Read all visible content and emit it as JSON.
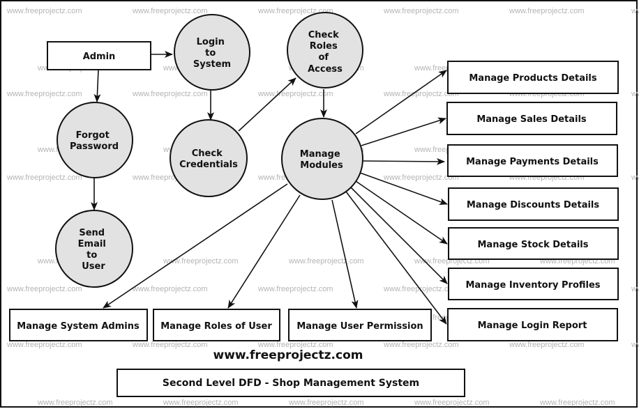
{
  "diagram": {
    "type": "Data Flow Diagram - Level 2",
    "title": "Second Level DFD - Shop Management System",
    "website": "www.freeprojectz.com",
    "watermark": "www.freeprojectz.com",
    "colors": {
      "process_fill": "#e2e2e2",
      "stroke": "#111111",
      "watermark": "#b4b4b4"
    },
    "entities": {
      "admin": "Admin",
      "products": "Manage Products Details",
      "sales": "Manage Sales Details",
      "payments": "Manage Payments Details",
      "discounts": "Manage Discounts Details",
      "stock": "Manage Stock Details",
      "inventory": "Manage Inventory Profiles",
      "login_report": "Manage Login Report",
      "system_admins": "Manage System Admins",
      "roles_of_user": "Manage Roles of User",
      "user_permission": "Manage User Permission"
    },
    "processes": {
      "login": [
        "Login",
        "to",
        "System"
      ],
      "check_roles": [
        "Check",
        "Roles",
        "of",
        "Access"
      ],
      "forgot": [
        "Forgot",
        "Password"
      ],
      "check_credentials": [
        "Check",
        "Credentials"
      ],
      "manage_modules": [
        "Manage",
        "Modules"
      ],
      "send_email": [
        "Send",
        "Email",
        "to",
        "User"
      ]
    },
    "flows": [
      [
        "Admin",
        "Login to System"
      ],
      [
        "Admin",
        "Forgot Password"
      ],
      [
        "Forgot Password",
        "Send Email to User"
      ],
      [
        "Login to System",
        "Check Credentials"
      ],
      [
        "Check Credentials",
        "Check Roles of Access"
      ],
      [
        "Check Roles of Access",
        "Manage Modules"
      ],
      [
        "Manage Modules",
        "Manage Products Details"
      ],
      [
        "Manage Modules",
        "Manage Sales Details"
      ],
      [
        "Manage Modules",
        "Manage Payments Details"
      ],
      [
        "Manage Modules",
        "Manage Discounts Details"
      ],
      [
        "Manage Modules",
        "Manage Stock Details"
      ],
      [
        "Manage Modules",
        "Manage Inventory Profiles"
      ],
      [
        "Manage Modules",
        "Manage Login Report"
      ],
      [
        "Manage Modules",
        "Manage System Admins"
      ],
      [
        "Manage Modules",
        "Manage Roles of User"
      ],
      [
        "Manage Modules",
        "Manage User Permission"
      ]
    ]
  }
}
